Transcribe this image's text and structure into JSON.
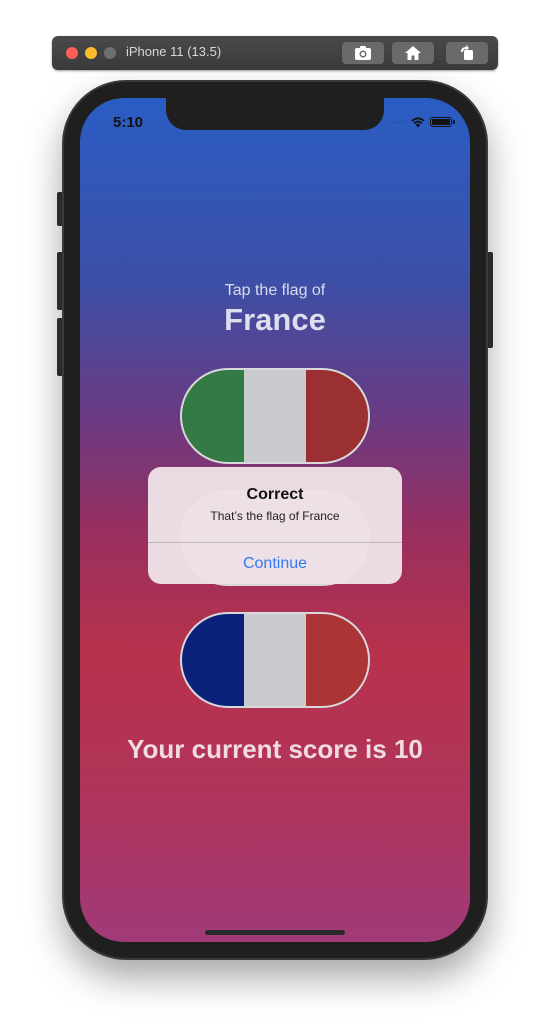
{
  "simulator": {
    "title": "iPhone 11 (13.5)",
    "buttons": [
      "screenshot-icon",
      "home-icon",
      "rotate-icon"
    ]
  },
  "status_bar": {
    "time": "5:10",
    "signal": "····"
  },
  "game": {
    "prompt": "Tap the flag of",
    "country": "France",
    "score_text": "Your current score is 10",
    "flags": [
      {
        "name": "Italy",
        "colors": [
          "#347a44",
          "#cacbcf",
          "#9b3033"
        ]
      },
      {
        "name": "Hidden",
        "colors": [
          "#cacbcf",
          "#cacbcf",
          "#cacbcf"
        ]
      },
      {
        "name": "France",
        "colors": [
          "#0a2279",
          "#cacbcf",
          "#ab3437"
        ]
      }
    ]
  },
  "alert": {
    "title": "Correct",
    "message": "That’s the flag of France",
    "button": "Continue"
  },
  "colors": {
    "accent": "#3478f6",
    "gradient_top": "#2a5dc4",
    "gradient_bottom": "#a03a78"
  }
}
